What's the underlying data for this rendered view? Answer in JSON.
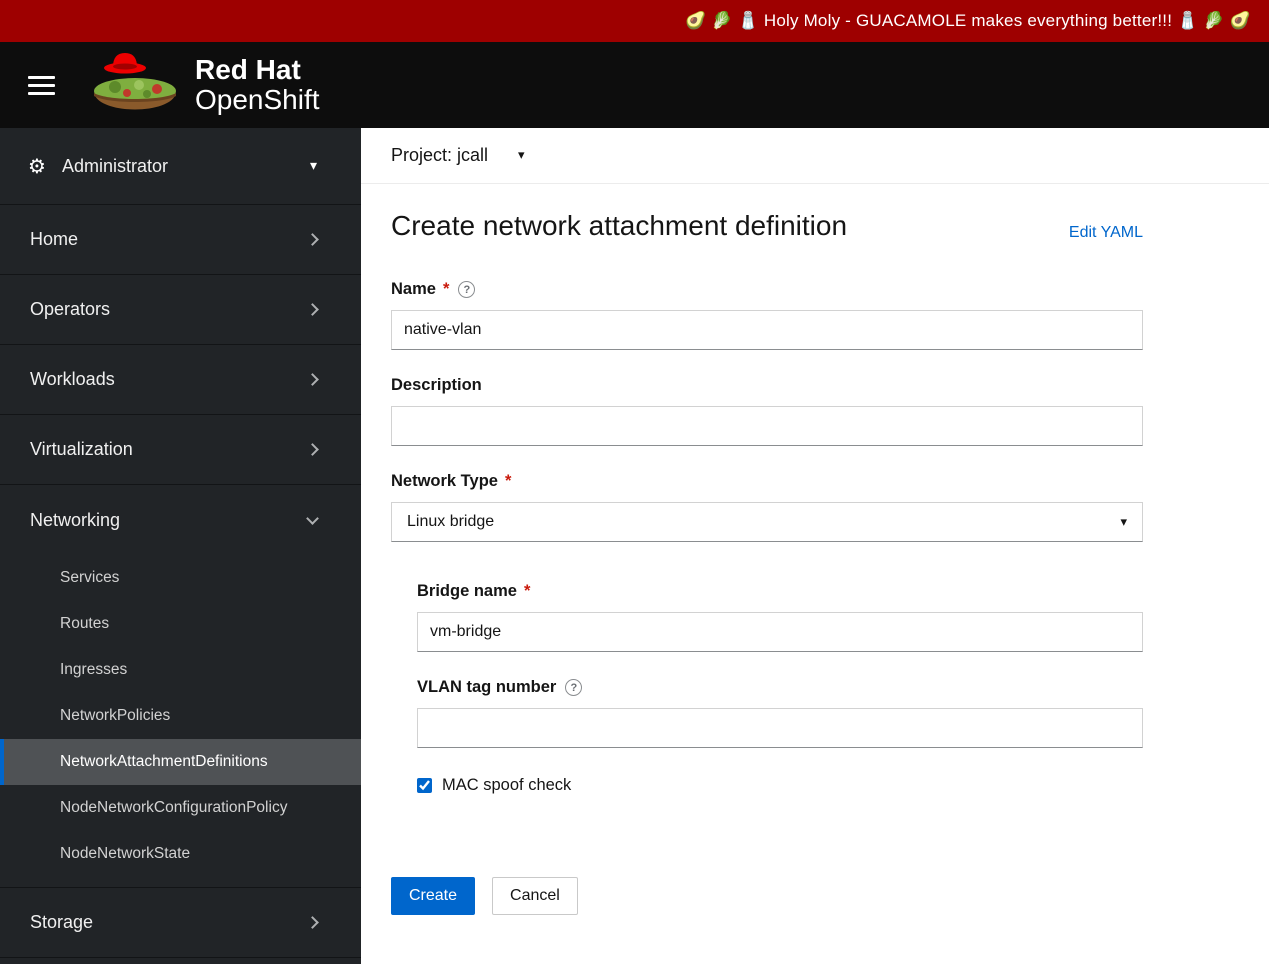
{
  "banner": {
    "text": "🥑  🥬  🧂  Holy Moly - GUACAMOLE makes everything better!!! 🧂  🥬  🥑",
    "bg_color": "#9e0000"
  },
  "header": {
    "brand_line1": "Red Hat",
    "brand_line2": "OpenShift"
  },
  "icons": {
    "gear": "⚙",
    "caret_down": "▾",
    "help": "?"
  },
  "sidebar": {
    "perspective": "Administrator",
    "items": {
      "home": "Home",
      "operators": "Operators",
      "workloads": "Workloads",
      "virtualization": "Virtualization",
      "networking": "Networking",
      "storage": "Storage"
    },
    "networking_items": [
      "Services",
      "Routes",
      "Ingresses",
      "NetworkPolicies",
      "NetworkAttachmentDefinitions",
      "NodeNetworkConfigurationPolicy",
      "NodeNetworkState"
    ],
    "active_item": "NetworkAttachmentDefinitions"
  },
  "toolbar": {
    "project_label": "Project: jcall"
  },
  "page": {
    "title": "Create network attachment definition",
    "edit_yaml_label": "Edit YAML"
  },
  "form": {
    "name": {
      "label": "Name",
      "required": "*",
      "value": "native-vlan"
    },
    "description": {
      "label": "Description",
      "value": ""
    },
    "network_type": {
      "label": "Network Type",
      "required": "*",
      "value": "Linux bridge"
    },
    "bridge_name": {
      "label": "Bridge name",
      "required": "*",
      "value": "vm-bridge"
    },
    "vlan": {
      "label": "VLAN tag number",
      "value": ""
    },
    "mac_spoof": {
      "label": "MAC spoof check",
      "checked_attr": "checked"
    },
    "create_label": "Create",
    "cancel_label": "Cancel"
  },
  "colors": {
    "accent": "#0066cc",
    "required": "#c9190b",
    "banner": "#9e0000"
  }
}
